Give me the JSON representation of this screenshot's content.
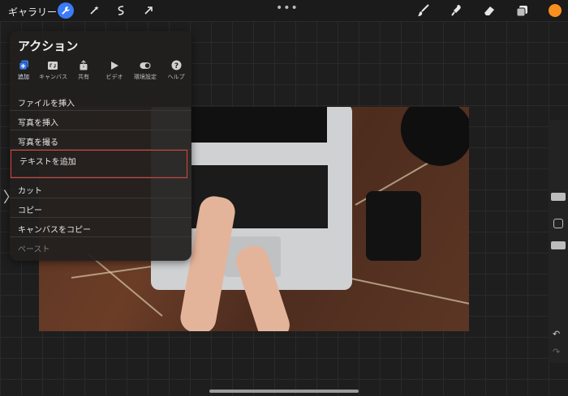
{
  "topbar": {
    "gallery_label": "ギャラリー",
    "more_label": "•••",
    "accent_color": "#3a7bf6",
    "current_color": "#f7901e",
    "tools_left": [
      "wrench-icon",
      "magic-wand-icon",
      "selection-icon",
      "transform-arrow-icon"
    ],
    "tools_right": [
      "brush-icon",
      "smudge-icon",
      "eraser-icon",
      "layers-icon"
    ]
  },
  "panel": {
    "title": "アクション",
    "tabs": [
      {
        "label": "追加",
        "icon": "add-icon",
        "active": true
      },
      {
        "label": "キャンバス",
        "icon": "canvas-icon",
        "active": false
      },
      {
        "label": "共有",
        "icon": "share-icon",
        "active": false
      },
      {
        "label": "ビデオ",
        "icon": "video-icon",
        "active": false
      },
      {
        "label": "環境設定",
        "icon": "toggle-icon",
        "active": false
      },
      {
        "label": "ヘルプ",
        "icon": "help-icon",
        "active": false
      }
    ],
    "menu": [
      {
        "label": "ファイルを挿入",
        "state": "normal"
      },
      {
        "label": "写真を挿入",
        "state": "normal"
      },
      {
        "label": "写真を撮る",
        "state": "normal"
      },
      {
        "label": "テキストを追加",
        "state": "highlighted"
      },
      {
        "label": "カット",
        "state": "normal"
      },
      {
        "label": "コピー",
        "state": "normal"
      },
      {
        "label": "キャンバスをコピー",
        "state": "normal"
      },
      {
        "label": "ペースト",
        "state": "disabled"
      }
    ],
    "highlight_color": "#d9423f"
  },
  "sidebar_handle": "〉",
  "rightbar": {
    "undo_label": "↶",
    "redo_label": "↷"
  }
}
